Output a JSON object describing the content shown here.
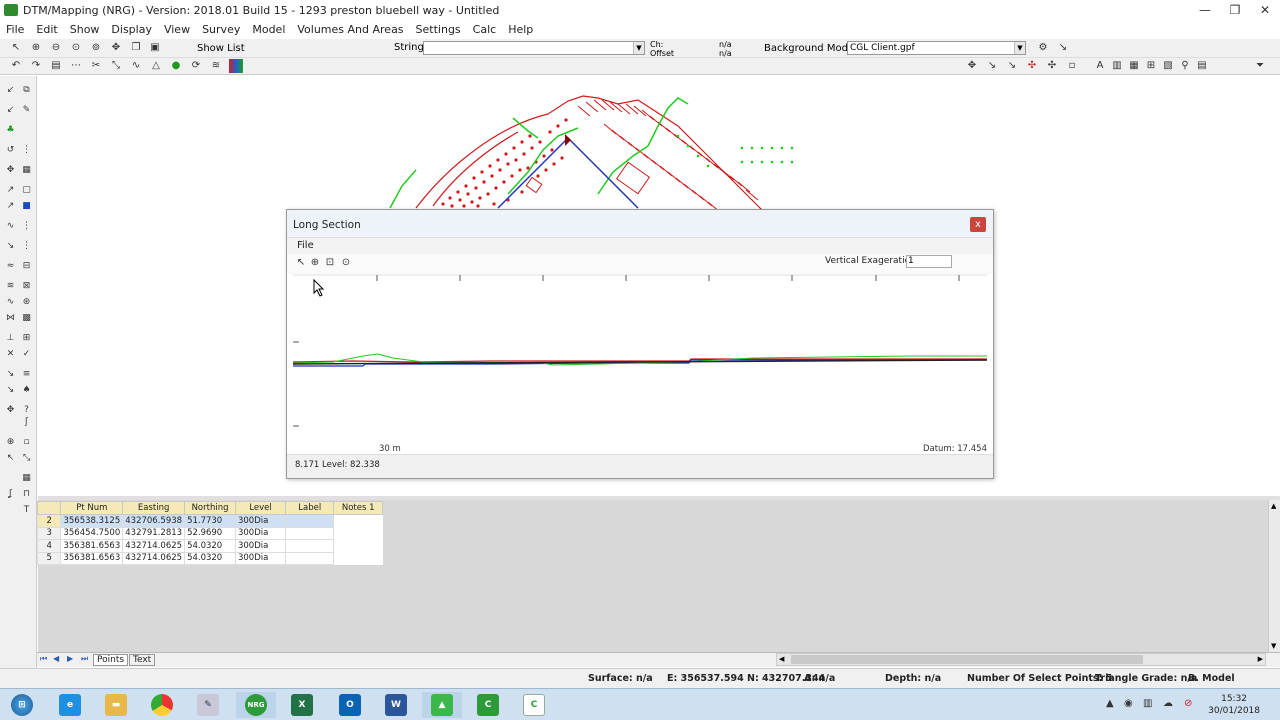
{
  "window": {
    "title": "DTM/Mapping (NRG) - Version: 2018.01 Build 15 - 1293 preston bluebell way - Untitled",
    "buttons": [
      "—",
      "❐",
      "✕"
    ]
  },
  "menubar": [
    "File",
    "Edit",
    "Show",
    "Display",
    "View",
    "Survey",
    "Model",
    "Volumes And Areas",
    "Settings",
    "Calc",
    "Help"
  ],
  "toolbar": {
    "show_list": "Show List",
    "string_label": "String",
    "string_value": "",
    "ch_label": "Ch:",
    "offset_label": "Offset",
    "na_top": "n/a",
    "na_bottom": "n/a",
    "background_model_label": "Background Model:",
    "background_model_value": "CGL Client.gpf"
  },
  "long_section": {
    "title": "Long Section",
    "close": "x",
    "menu_file": "File",
    "vertical_exaggeration_label": "Vertical Exageration",
    "vertical_exaggeration_value": "1",
    "x_label": "30 m",
    "datum_label": "Datum: 17.454",
    "status": "8.171 Level: 82.338"
  },
  "table": {
    "columns": [
      "Pt Num",
      "Easting",
      "Northing",
      "Level",
      "Label",
      "Notes 1"
    ],
    "rows": [
      {
        "num": "2",
        "easting": "356538.3125",
        "northing": "432706.5938",
        "level": "51.7730",
        "label": "300Dia",
        "notes": ""
      },
      {
        "num": "3",
        "easting": "356454.7500",
        "northing": "432791.2813",
        "level": "52.9690",
        "label": "300Dia",
        "notes": ""
      },
      {
        "num": "4",
        "easting": "356381.6563",
        "northing": "432714.0625",
        "level": "54.0320",
        "label": "300Dia",
        "notes": ""
      },
      {
        "num": "5",
        "easting": "356381.6563",
        "northing": "432714.0625",
        "level": "54.0320",
        "label": "300Dia",
        "notes": ""
      }
    ]
  },
  "sheet_tabs": [
    "Points",
    "Text"
  ],
  "statusbar": {
    "surface": "Surface: n/a",
    "coords": "E: 356537.594  N: 432707.344",
    "a": "A: n/a",
    "depth": "Depth: n/a",
    "selected_points": "Number Of Select Points: 5",
    "triangle_grade": "Triangle Grade: n/a",
    "model": "B. Model"
  },
  "taskbar": {
    "time": "15:32",
    "date": "30/01/2018"
  },
  "colors": {
    "accent_red": "#d01a1a",
    "accent_green": "#1ecb1e",
    "accent_blue": "#1a2fc0",
    "grid_header": "#f5e9b5",
    "selection": "#cfe0f5"
  }
}
